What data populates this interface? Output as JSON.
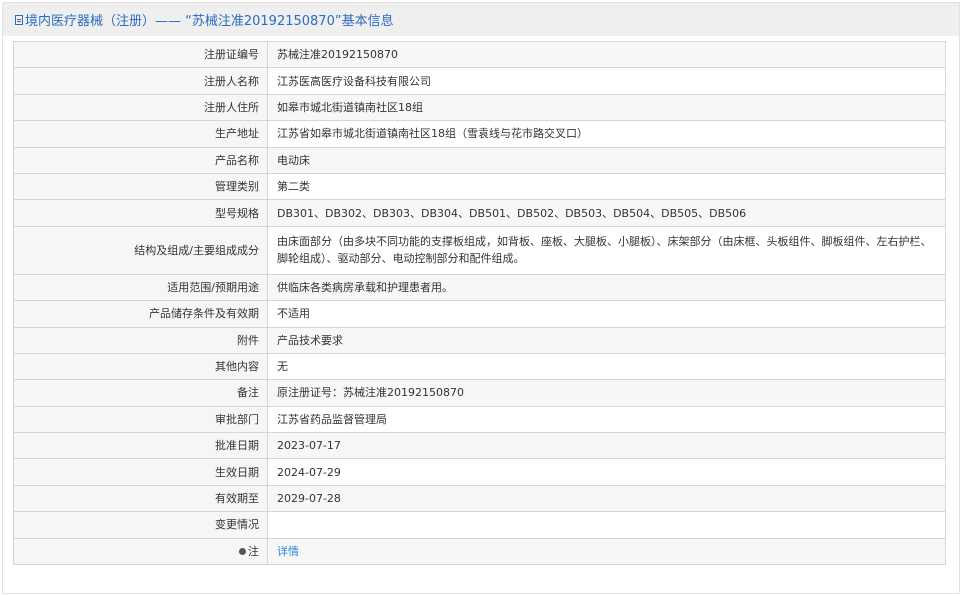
{
  "header": {
    "title": "境内医疗器械（注册）—— “苏械注准20192150870”基本信息"
  },
  "rows": [
    {
      "label": "注册证编号",
      "value": "苏械注准20192150870"
    },
    {
      "label": "注册人名称",
      "value": "江苏医高医疗设备科技有限公司"
    },
    {
      "label": "注册人住所",
      "value": "如皋市城北街道镇南社区18组"
    },
    {
      "label": "生产地址",
      "value": "江苏省如皋市城北街道镇南社区18组（雪袁线与花市路交叉口）"
    },
    {
      "label": "产品名称",
      "value": "电动床"
    },
    {
      "label": "管理类别",
      "value": "第二类"
    },
    {
      "label": "型号规格",
      "value": "DB301、DB302、DB303、DB304、DB501、DB502、DB503、DB504、DB505、DB506"
    },
    {
      "label": "结构及组成/主要组成成分",
      "value": "由床面部分（由多块不同功能的支撑板组成，如背板、座板、大腿板、小腿板）、床架部分（由床框、头板组件、脚板组件、左右护栏、脚轮组成）、驱动部分、电动控制部分和配件组成。"
    },
    {
      "label": "适用范围/预期用途",
      "value": "供临床各类病房承载和护理患者用。"
    },
    {
      "label": "产品储存条件及有效期",
      "value": "不适用"
    },
    {
      "label": "附件",
      "value": "产品技术要求"
    },
    {
      "label": "其他内容",
      "value": "无"
    },
    {
      "label": "备注",
      "value": "原注册证号：苏械注准20192150870"
    },
    {
      "label": "审批部门",
      "value": "江苏省药品监督管理局"
    },
    {
      "label": "批准日期",
      "value": "2023-07-17"
    },
    {
      "label": "生效日期",
      "value": "2024-07-29"
    },
    {
      "label": "有效期至",
      "value": "2029-07-28"
    },
    {
      "label": "变更情况",
      "value": ""
    }
  ],
  "note": {
    "label": "注",
    "link": "详情"
  }
}
